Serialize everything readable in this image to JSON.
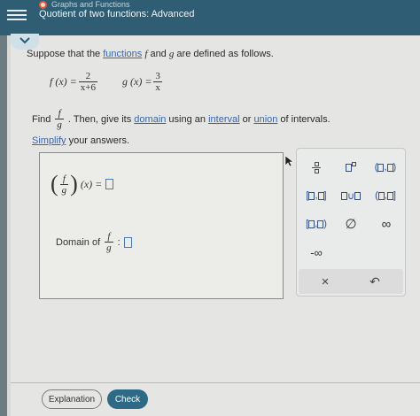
{
  "header": {
    "breadcrumb": "Graphs and Functions",
    "title": "Quotient of two functions: Advanced"
  },
  "problem": {
    "intro_prefix": "Suppose that the ",
    "intro_link": "functions",
    "intro_mid1": " ",
    "f_var": "f",
    "intro_and": " and ",
    "g_var": "g",
    "intro_suffix": " are defined as follows.",
    "f_lhs": "f (x) =",
    "f_num": "2",
    "f_den": "x+6",
    "g_lhs": "g (x) =",
    "g_num": "3",
    "g_den": "x",
    "find_word": "Find",
    "find_frac_num": "f",
    "find_frac_den": "g",
    "find_then": ". Then, give its ",
    "domain_link": "domain",
    "using_text": " using an ",
    "interval_link": "interval",
    "or_text": " or ",
    "union_link": "union",
    "of_intervals": " of intervals.",
    "simplify_link": "Simplify",
    "simplify_rest": " your answers."
  },
  "answer": {
    "quot_num": "f",
    "quot_den": "g",
    "quot_rhs": "(x) =",
    "domain_label": "Domain of",
    "domain_num": "f",
    "domain_den": "g",
    "domain_colon": ":"
  },
  "keypad": {
    "union": "∪",
    "empty_set": "∅",
    "infinity": "∞",
    "neg_infinity": "-∞",
    "clear": "×",
    "undo": "↶"
  },
  "footer": {
    "explanation_label": "Explanation",
    "check_label": "Check"
  }
}
